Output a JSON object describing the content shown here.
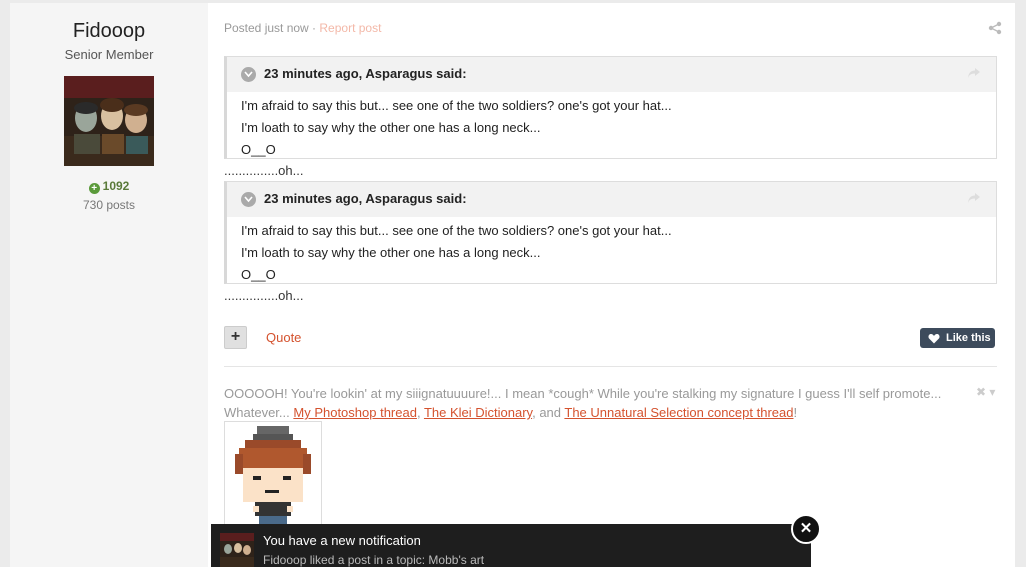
{
  "author": {
    "name": "Fidooop",
    "title": "Senior Member",
    "reputation": "1092",
    "posts": "730 posts"
  },
  "post": {
    "meta_time": "Posted just now",
    "meta_sep": " · ",
    "report_label": "Report post",
    "quotes": [
      {
        "citation": "23 minutes ago, Asparagus said:",
        "lines": [
          "I'm afraid to say this but... see one of the two soldiers? one's got your hat...",
          "I'm loath to say why the other one has a long neck...",
          "O__O"
        ],
        "reply": "...............oh..."
      },
      {
        "citation": "23 minutes ago, Asparagus said:",
        "lines": [
          "I'm afraid to say this but... see one of the two soldiers? one's got your hat...",
          "I'm loath to say why the other one has a long neck...",
          "O__O"
        ],
        "reply": "...............oh..."
      }
    ],
    "plus_label": "+",
    "quote_label": "Quote",
    "like_label": "Like this"
  },
  "signature": {
    "text_1": "OOOOOH! You're lookin' at my siiignatuuuure!... I mean *cough* While you're stalking my signature I guess I'll self promote... Whatever... ",
    "link_1": "My Photoshop thread",
    "sep_1": ", ",
    "link_2": "The Klei Dictionary",
    "sep_2": ", and ",
    "link_3": "The Unnatural Selection concept thread",
    "end": "!",
    "controls": "✖ ▾"
  },
  "notification": {
    "title": "You have a new notification",
    "body": "Fidooop liked a post in a topic: Mobb's art",
    "close_label": "✕"
  },
  "colors": {
    "accent": "#d4522e",
    "like_button": "#3d4b5c",
    "reputation": "#5a7a3a"
  }
}
